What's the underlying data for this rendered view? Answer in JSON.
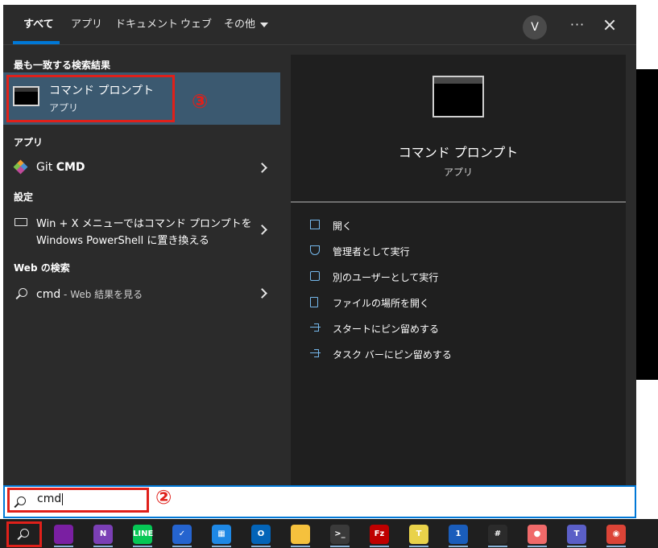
{
  "tabs": [
    {
      "label": "すべて",
      "active": true
    },
    {
      "label": "アプリ"
    },
    {
      "label": "ドキュメント"
    },
    {
      "label": "ウェブ"
    },
    {
      "label": "その他"
    }
  ],
  "user_initial": "V",
  "more_label": "···",
  "sections": {
    "best_match": "最も一致する検索結果",
    "apps": "アプリ",
    "settings": "設定",
    "web": "Web の検索"
  },
  "best_match": {
    "name": "コマンド プロンプト",
    "type": "アプリ"
  },
  "annotations": {
    "three": "③",
    "two": "②"
  },
  "app_result": {
    "name_prefix": "Git ",
    "name_bold": "CMD"
  },
  "setting_result": {
    "line1": "Win + X メニューではコマンド プロンプトを",
    "line2": "Windows PowerShell に置き換える"
  },
  "web_result": {
    "query": "cmd",
    "suffix": " - Web 結果を見る"
  },
  "preview": {
    "title": "コマンド プロンプト",
    "subtitle": "アプリ",
    "actions": [
      {
        "label": "開く",
        "icon": "open-icon"
      },
      {
        "label": "管理者として実行",
        "icon": "shield-icon"
      },
      {
        "label": "別のユーザーとして実行",
        "icon": "user-icon"
      },
      {
        "label": "ファイルの場所を開く",
        "icon": "file-icon"
      },
      {
        "label": "スタートにピン留めする",
        "icon": "pin-icon"
      },
      {
        "label": "タスク バーにピン留めする",
        "icon": "pin-icon"
      }
    ]
  },
  "search": {
    "value": "cmd"
  },
  "taskbar": {
    "icons": [
      {
        "name": "music-app-icon",
        "color": "#7a1fa2"
      },
      {
        "name": "onenote-icon",
        "color": "#7b3fb5",
        "label": "N"
      },
      {
        "name": "line-icon",
        "color": "#06c755",
        "label": "LINE"
      },
      {
        "name": "todo-icon",
        "color": "#2564cf",
        "label": "✓"
      },
      {
        "name": "calendar-icon",
        "color": "#1e88e5",
        "label": "▦"
      },
      {
        "name": "outlook-icon",
        "color": "#0364b8",
        "label": "O"
      },
      {
        "name": "file-explorer-icon",
        "color": "#f5c13d",
        "label": ""
      },
      {
        "name": "terminal-icon",
        "color": "#3a3a3a",
        "label": ">_"
      },
      {
        "name": "filezilla-icon",
        "color": "#bf0000",
        "label": "Fz"
      },
      {
        "name": "teraterm-icon",
        "color": "#e9d24a",
        "label": "T"
      },
      {
        "name": "1password-icon",
        "color": "#1a5dbb",
        "label": "1"
      },
      {
        "name": "slack-icon",
        "color": "#2b2b2b",
        "label": "#"
      },
      {
        "name": "asana-icon",
        "color": "#f06a6a",
        "label": "●"
      },
      {
        "name": "teams-icon",
        "color": "#5b5fc7",
        "label": "T"
      },
      {
        "name": "chrome-icon",
        "color": "#db4437",
        "label": "◉"
      }
    ]
  }
}
